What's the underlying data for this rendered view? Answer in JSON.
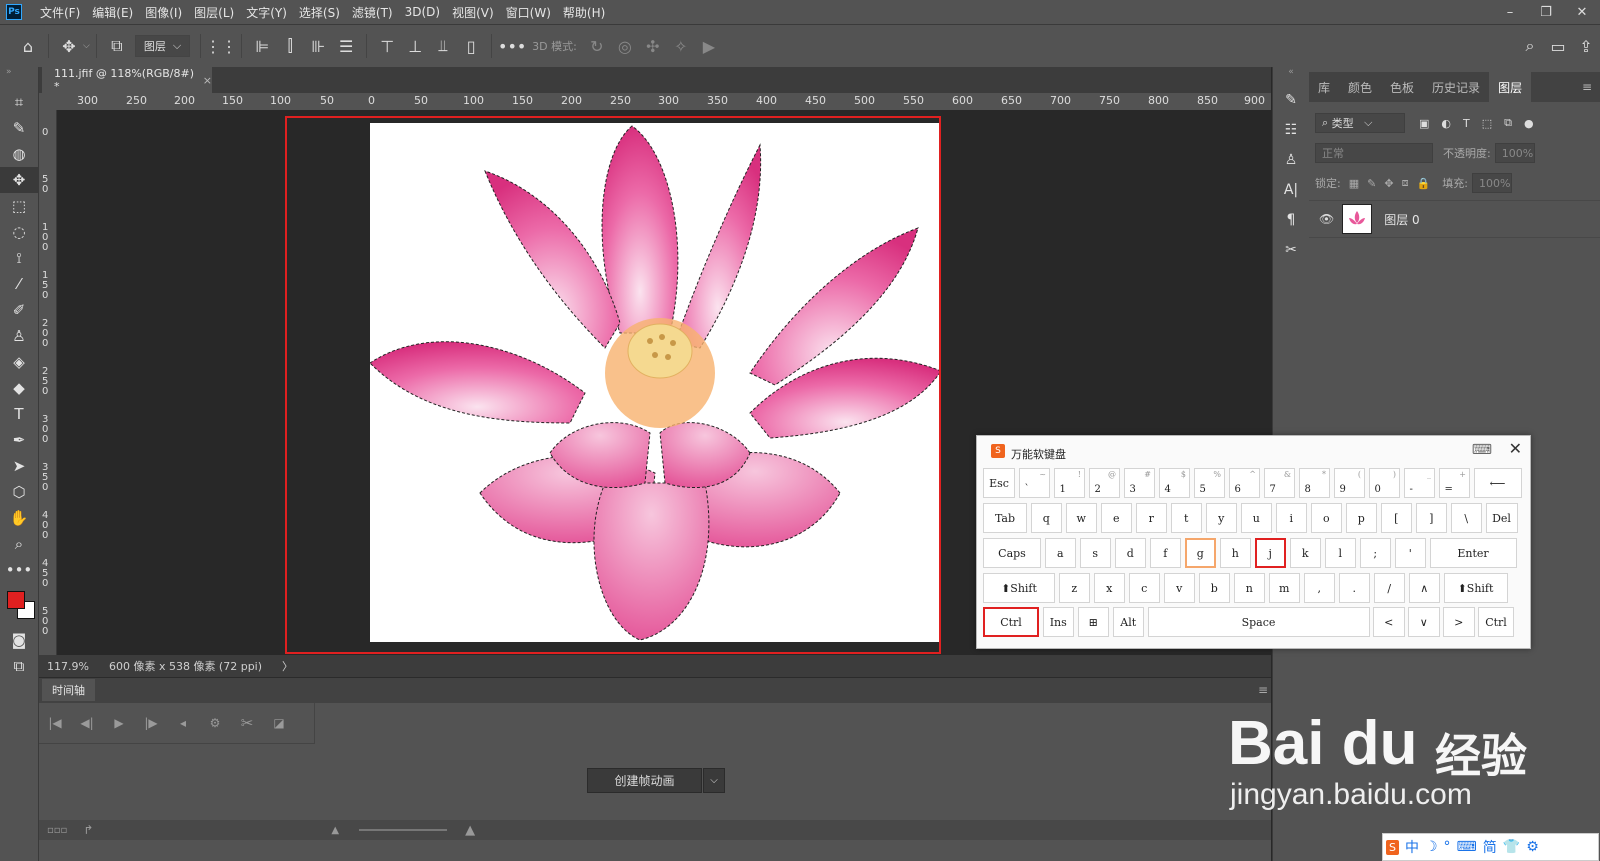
{
  "app": {
    "logo": "Ps"
  },
  "menus": [
    "文件(F)",
    "编辑(E)",
    "图像(I)",
    "图层(L)",
    "文字(Y)",
    "选择(S)",
    "滤镜(T)",
    "3D(D)",
    "视图(V)",
    "窗口(W)",
    "帮助(H)"
  ],
  "window_controls": {
    "minimize": "–",
    "restore": "❐",
    "close": "✕"
  },
  "options": {
    "layer_select": "图层",
    "mode3d": "3D 模式:"
  },
  "document": {
    "tab_title": "111.jfif @ 118%(RGB/8#) *",
    "tab_close": "×"
  },
  "ruler_h": [
    "300",
    "250",
    "200",
    "150",
    "100",
    "50",
    "0",
    "50",
    "100",
    "150",
    "200",
    "250",
    "300",
    "350",
    "400",
    "450",
    "500",
    "550",
    "600",
    "650",
    "700",
    "750",
    "800",
    "850",
    "900"
  ],
  "ruler_v": [
    "0",
    "50",
    "100",
    "150",
    "200",
    "250",
    "300",
    "350",
    "400",
    "450",
    "500"
  ],
  "status": {
    "zoom": "117.9%",
    "info": "600 像素 x 538 像素 (72 ppi)",
    "arrow": "〉"
  },
  "timeline": {
    "tab": "时间轴",
    "create_button": "创建帧动画",
    "dropdown": "⌵"
  },
  "panel": {
    "tabs": [
      "库",
      "颜色",
      "色板",
      "历史记录",
      "图层"
    ],
    "active_tab": "图层",
    "filter": "类型",
    "blend_mode": "正常",
    "opacity_label": "不透明度:",
    "opacity_value": "100%",
    "lock_label": "锁定:",
    "fill_label": "填充:",
    "fill_value": "100%",
    "layer_name": "图层 0"
  },
  "keyboard": {
    "title": "万能软键盘",
    "row1": [
      {
        "main": "Esc"
      },
      {
        "main": "`",
        "top": "~"
      },
      {
        "main": "1",
        "top": "!"
      },
      {
        "main": "2",
        "top": "@"
      },
      {
        "main": "3",
        "top": "#"
      },
      {
        "main": "4",
        "top": "$"
      },
      {
        "main": "5",
        "top": "%"
      },
      {
        "main": "6",
        "top": "^"
      },
      {
        "main": "7",
        "top": "&"
      },
      {
        "main": "8",
        "top": "*"
      },
      {
        "main": "9",
        "top": "("
      },
      {
        "main": "0",
        "top": ")"
      },
      {
        "main": "-",
        "top": "_"
      },
      {
        "main": "=",
        "top": "+"
      },
      {
        "main": "⟵"
      }
    ],
    "row2": [
      "Tab",
      "q",
      "w",
      "e",
      "r",
      "t",
      "y",
      "u",
      "i",
      "o",
      "p",
      "[",
      "]",
      "\\",
      "Del"
    ],
    "row3": [
      "Caps",
      "a",
      "s",
      "d",
      "f",
      "g",
      "h",
      "j",
      "k",
      "l",
      ";",
      "'",
      "Enter"
    ],
    "row4": [
      "⬆Shift",
      "z",
      "x",
      "c",
      "v",
      "b",
      "n",
      "m",
      ",",
      ".",
      "/",
      "∧",
      "⬆Shift"
    ],
    "row5": [
      "Ctrl",
      "Ins",
      "⊞",
      "Alt",
      "Space",
      "<",
      "∨",
      ">",
      "Ctrl"
    ]
  },
  "watermark": {
    "brand": "Bai du",
    "suffix": "经验",
    "url": "jingyan.baidu.com"
  },
  "ime": [
    "中",
    "☽",
    "°",
    "⌨",
    "简",
    "👕",
    "⚙"
  ],
  "colors": {
    "highlight": "#e02020",
    "lotus": "#e8589a",
    "accent": "#f0641e"
  }
}
